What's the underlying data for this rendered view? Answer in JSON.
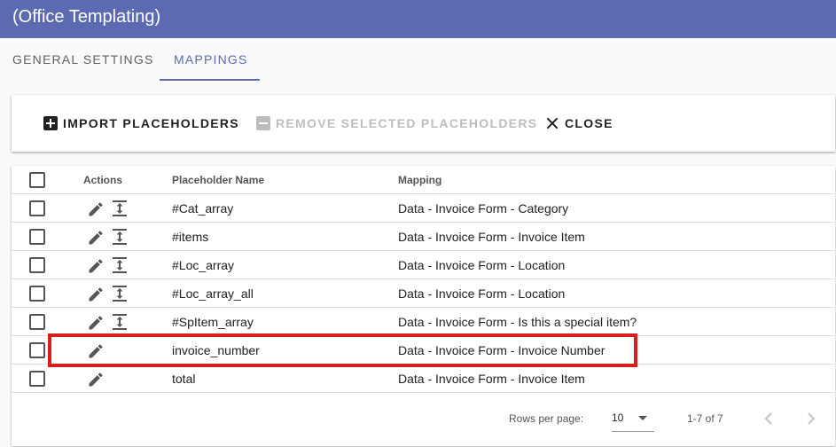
{
  "app": {
    "title": "(Office Templating)"
  },
  "tabs": [
    {
      "label": "General Settings"
    },
    {
      "label": "Mappings"
    }
  ],
  "toolbar": {
    "import_label": "IMPORT PLACEHOLDERS",
    "remove_label": "REMOVE SELECTED PLACEHOLDERS",
    "close_label": "CLOSE"
  },
  "table": {
    "headers": {
      "actions": "Actions",
      "name": "Placeholder Name",
      "mapping": "Mapping"
    },
    "rows": [
      {
        "name": "#Cat_array",
        "mapping": "Data - Invoice Form - Category"
      },
      {
        "name": "#items",
        "mapping": "Data - Invoice Form - Invoice Item"
      },
      {
        "name": "#Loc_array",
        "mapping": "Data - Invoice Form - Location"
      },
      {
        "name": "#Loc_array_all",
        "mapping": "Data - Invoice Form - Location"
      },
      {
        "name": "#SpItem_array",
        "mapping": "Data - Invoice Form - Is this a special item?"
      },
      {
        "name": "invoice_number",
        "mapping": "Data - Invoice Form - Invoice Number"
      },
      {
        "name": "total",
        "mapping": "Data - Invoice Form - Invoice Item"
      }
    ]
  },
  "pagination": {
    "rows_per_page_label": "Rows per page:",
    "rows_per_page_value": "10",
    "range": "1-7 of 7"
  },
  "colors": {
    "primary": "#5c6bb1",
    "highlight": "#d71e1e",
    "disabled": "#bdbdbd"
  }
}
